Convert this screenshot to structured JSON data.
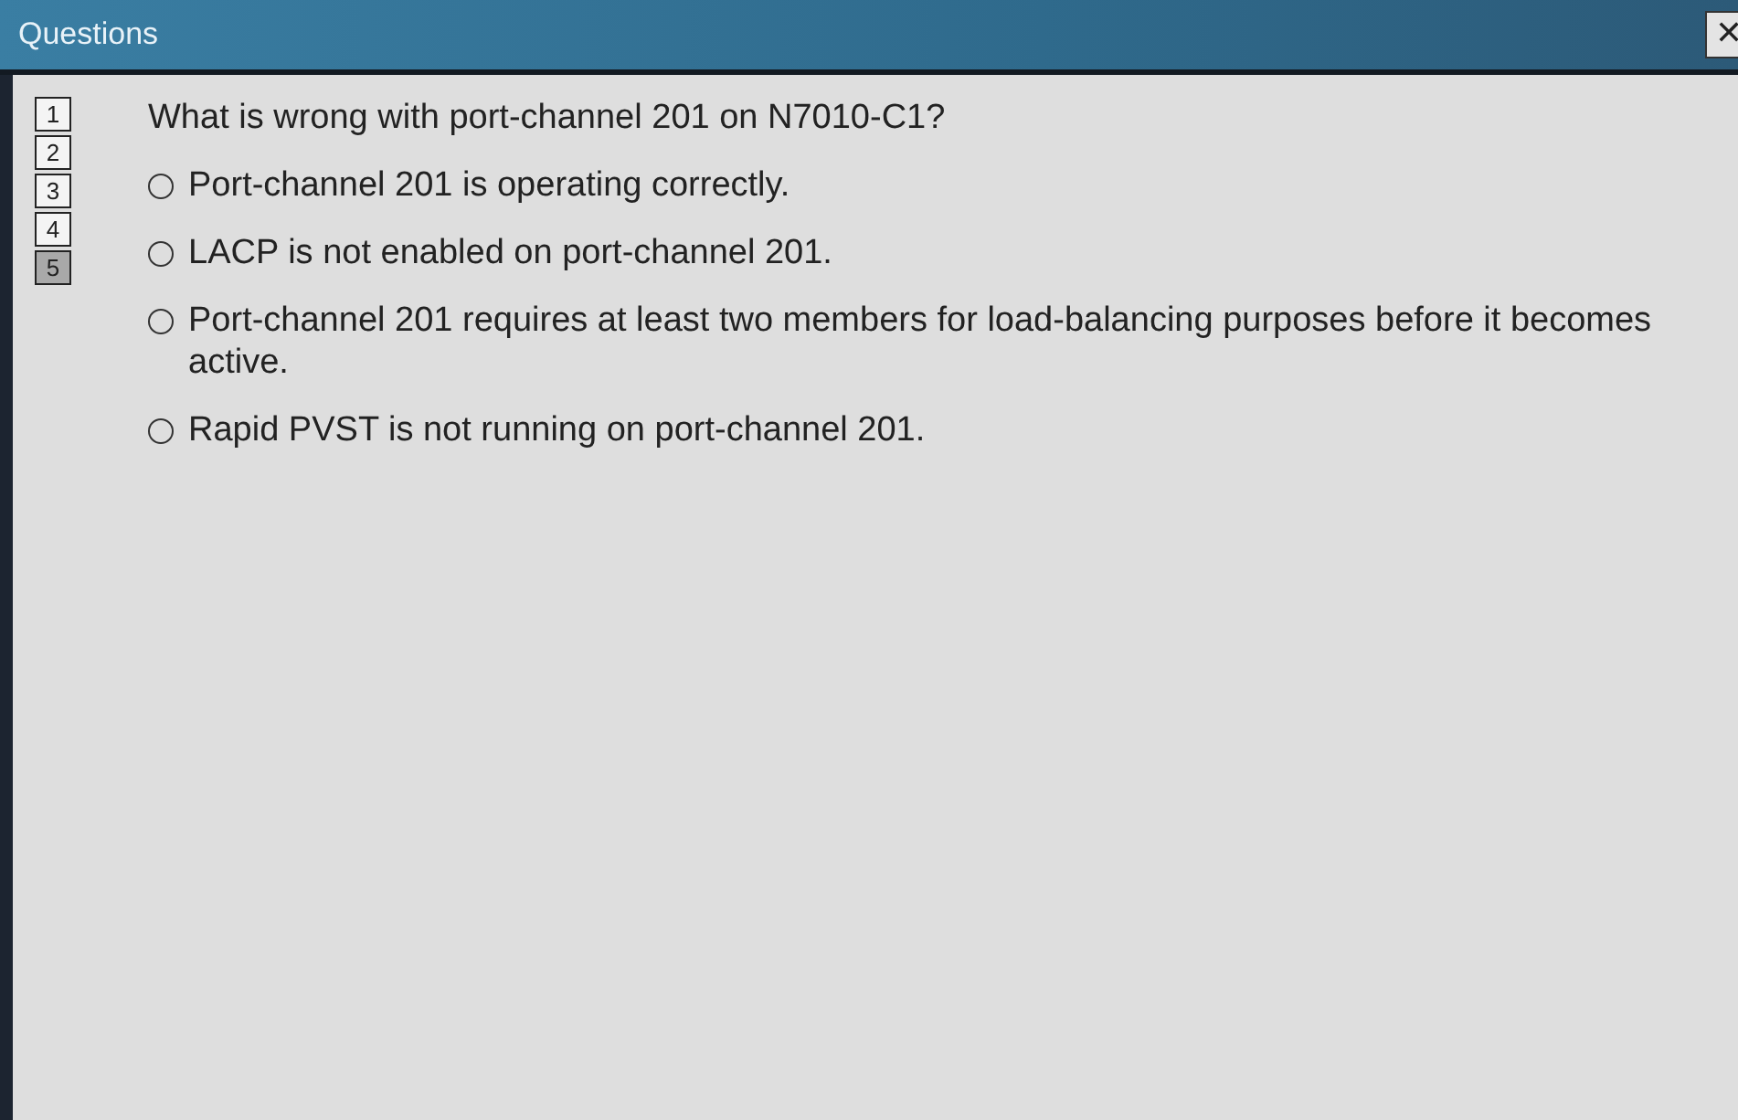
{
  "window": {
    "title": "Questions",
    "close": "✕"
  },
  "question_numbers": [
    {
      "label": "1",
      "selected": false
    },
    {
      "label": "2",
      "selected": false
    },
    {
      "label": "3",
      "selected": false
    },
    {
      "label": "4",
      "selected": false
    },
    {
      "label": "5",
      "selected": true
    }
  ],
  "question": "What is wrong with port-channel 201 on N7010-C1?",
  "options": [
    {
      "label": "Port-channel 201 is operating correctly.",
      "selected": false
    },
    {
      "label": "LACP is not enabled on port-channel 201.",
      "selected": false
    },
    {
      "label": "Port-channel 201 requires at least two members for load-balancing purposes before it becomes active.",
      "selected": false
    },
    {
      "label": "Rapid PVST is not running on port-channel 201.",
      "selected": false
    }
  ]
}
